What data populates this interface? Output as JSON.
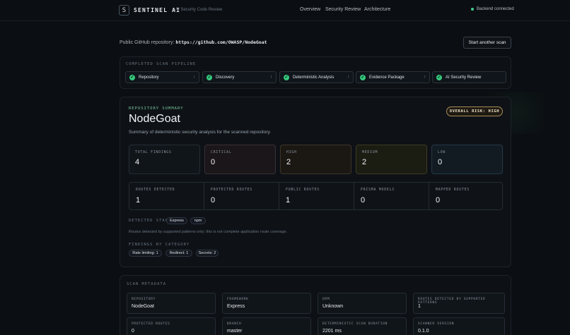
{
  "header": {
    "logo_letter": "S",
    "brand": "SENTINEL AI",
    "subtitle": "AI Security Code Review",
    "nav": [
      "Overview",
      "Security Review",
      "Architecture"
    ],
    "status": "Backend connected",
    "status_color": "#3ecf8e"
  },
  "repo": {
    "label": "Public GitHub repository:",
    "url": "https://github.com/OWASP/NodeGoat",
    "scan_button": "Start another scan"
  },
  "pipeline": {
    "title": "COMPLETED SCAN PIPELINE",
    "steps": [
      {
        "label": "Repository",
        "arrow": "↓"
      },
      {
        "label": "Discovery",
        "arrow": "↓"
      },
      {
        "label": "Deterministic Analysis",
        "arrow": "↓"
      },
      {
        "label": "Evidence Package",
        "arrow": "↓"
      },
      {
        "label": "AI Security Review",
        "arrow": ""
      }
    ]
  },
  "summary": {
    "kicker": "REPOSITORY SUMMARY",
    "name": "NodeGoat",
    "description": "Summary of deterministic security analysis for the scanned repository.",
    "risk": "OVERALL RISK: HIGH",
    "severity": [
      {
        "label": "TOTAL FINDINGS",
        "value": "4",
        "bg": "#10151a",
        "border": "#252c35"
      },
      {
        "label": "CRITICAL",
        "value": "0",
        "bg": "#1a1619",
        "border": "#3a2f36"
      },
      {
        "label": "HIGH",
        "value": "2",
        "bg": "#1b1814",
        "border": "#3d3427"
      },
      {
        "label": "MEDIUM",
        "value": "2",
        "bg": "#1b1c12",
        "border": "#3d3c22"
      },
      {
        "label": "LOW",
        "value": "0",
        "bg": "#121b22",
        "border": "#253847"
      }
    ],
    "routes": [
      {
        "label": "ROUTES DETECTED",
        "value": "1"
      },
      {
        "label": "PROTECTED ROUTES",
        "value": "0"
      },
      {
        "label": "PUBLIC ROUTES",
        "value": "1"
      },
      {
        "label": "PRISMA MODELS",
        "value": "0"
      },
      {
        "label": "MAPPED ROUTES",
        "value": "0"
      }
    ],
    "stack_title": "DETECTED STACK",
    "stack": [
      "Express",
      "npm"
    ],
    "note": "Routes detected by supported patterns only; this is not complete application route coverage.",
    "cat_title": "FINDINGS BY CATEGORY",
    "categories": [
      "Rate limiting: 1",
      "Redirect: 1",
      "Secrets: 2"
    ]
  },
  "metadata": {
    "title": "SCAN METADATA",
    "cells": [
      {
        "label": "REPOSITORY",
        "value": "NodeGoat"
      },
      {
        "label": "FRAMEWORK",
        "value": "Express"
      },
      {
        "label": "ORM",
        "value": "Unknown"
      },
      {
        "label": "ROUTES DETECTED BY SUPPORTED PATTERNS",
        "value": "1"
      },
      {
        "label": "PROTECTED ROUTES",
        "value": "0"
      },
      {
        "label": "BRANCH",
        "value": "master"
      },
      {
        "label": "DETERMINISTIC SCAN DURATION",
        "value": "2201 ms"
      },
      {
        "label": "SCANNER VERSION",
        "value": "0.1.0"
      }
    ]
  }
}
